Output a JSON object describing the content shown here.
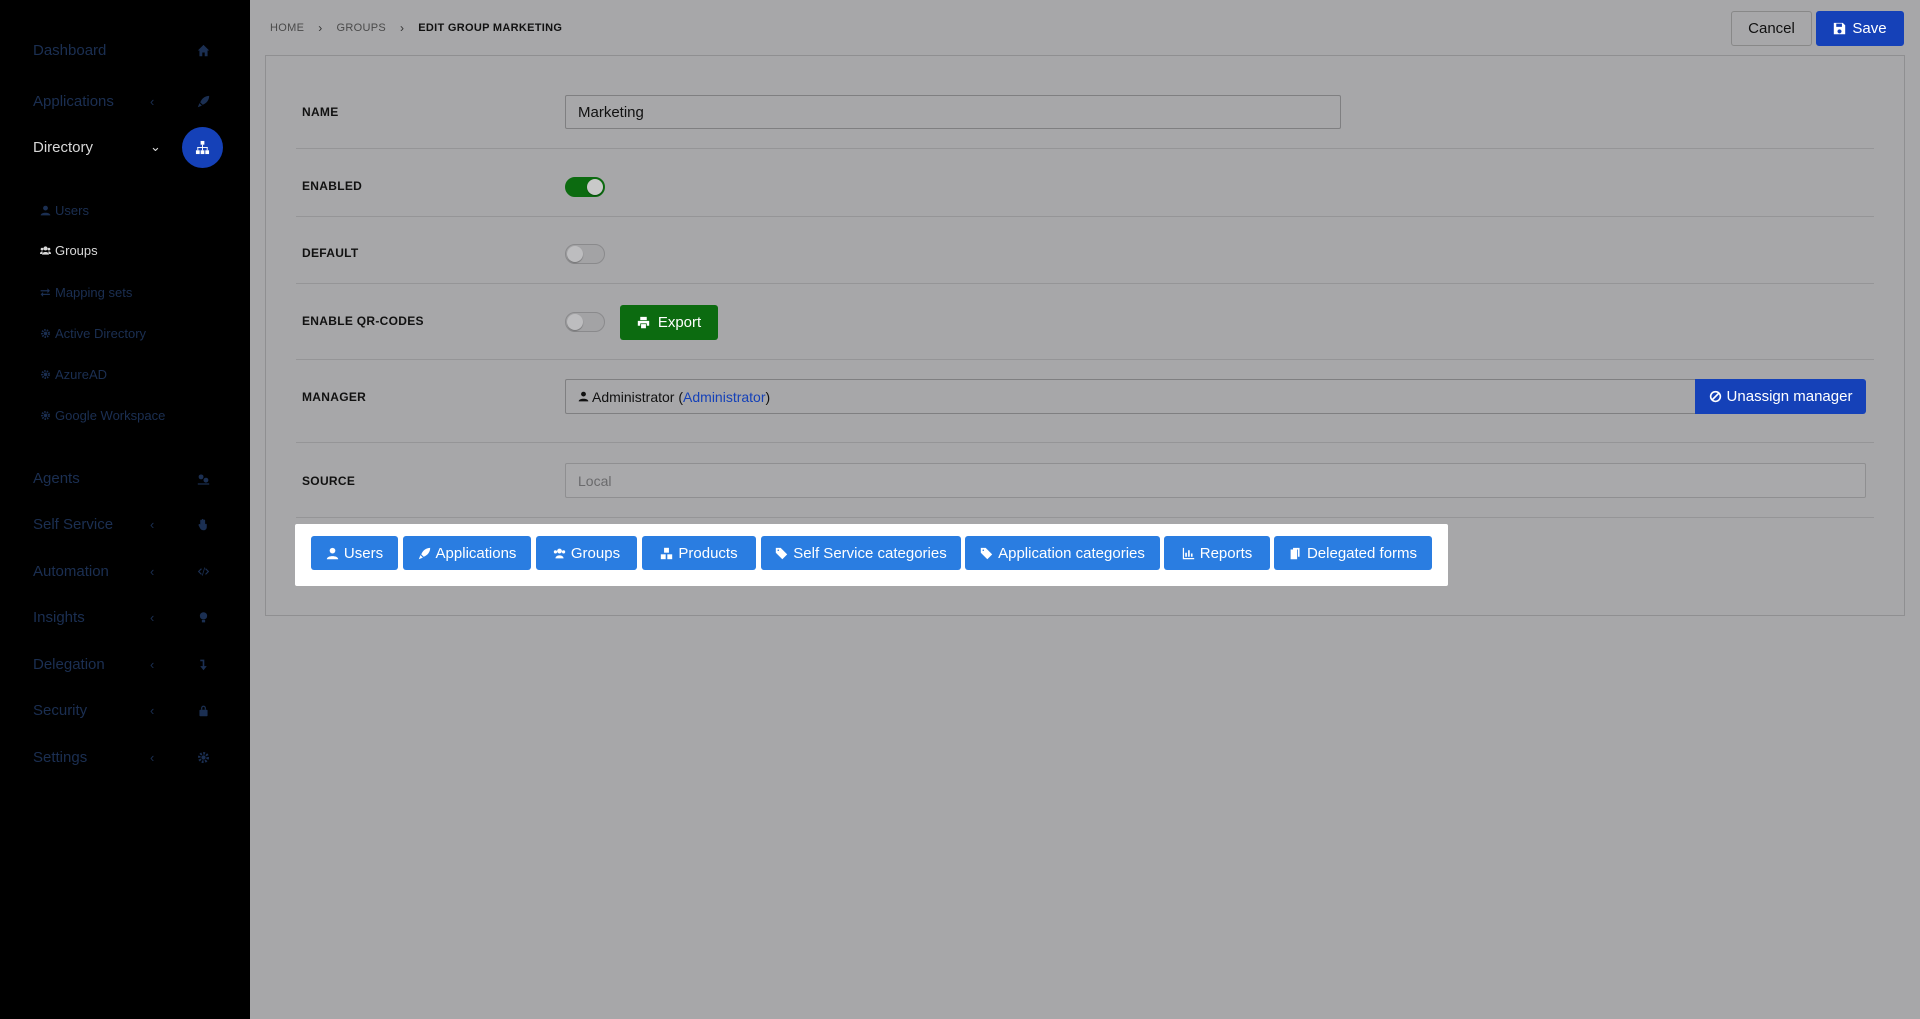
{
  "sidebar": {
    "items": [
      {
        "label": "Dashboard",
        "icon": "home-icon"
      },
      {
        "label": "Applications",
        "icon": "rocket-icon"
      },
      {
        "label": "Directory",
        "icon": "sitemap-icon"
      },
      {
        "label": "Agents",
        "icon": "agents-icon"
      },
      {
        "label": "Self Service",
        "icon": "hand-icon"
      },
      {
        "label": "Automation",
        "icon": "code-icon"
      },
      {
        "label": "Insights",
        "icon": "lightbulb-icon"
      },
      {
        "label": "Delegation",
        "icon": "delegation-icon"
      },
      {
        "label": "Security",
        "icon": "lock-icon"
      },
      {
        "label": "Settings",
        "icon": "gear-icon"
      }
    ],
    "directory_subitems": [
      {
        "label": "Users",
        "icon": "user-icon"
      },
      {
        "label": "Groups",
        "icon": "users-icon"
      },
      {
        "label": "Mapping sets",
        "icon": "exchange-icon"
      },
      {
        "label": "Active Directory",
        "icon": "gear-icon"
      },
      {
        "label": "AzureAD",
        "icon": "gear-icon"
      },
      {
        "label": "Google Workspace",
        "icon": "gear-icon"
      }
    ]
  },
  "breadcrumb": [
    "HOME",
    "GROUPS",
    "EDIT GROUP MARKETING"
  ],
  "toolbar": {
    "cancel_label": "Cancel",
    "save_label": "Save"
  },
  "form": {
    "name_label": "NAME",
    "name_value": "Marketing",
    "enabled_label": "ENABLED",
    "enabled": true,
    "default_label": "DEFAULT",
    "default": false,
    "qr_label": "ENABLE QR-CODES",
    "qr_enabled": false,
    "export_label": "Export",
    "manager_label": "MANAGER",
    "manager_name": "Administrator",
    "manager_link": "Administrator",
    "unassign_label": "Unassign manager",
    "source_label": "SOURCE",
    "source_value": "Local"
  },
  "tabs": [
    {
      "label": "Users",
      "icon": "user-icon"
    },
    {
      "label": "Applications",
      "icon": "rocket-icon"
    },
    {
      "label": "Groups",
      "icon": "users-icon"
    },
    {
      "label": "Products",
      "icon": "cubes-icon"
    },
    {
      "label": "Self Service categories",
      "icon": "tags-icon"
    },
    {
      "label": "Application categories",
      "icon": "tags-icon"
    },
    {
      "label": "Reports",
      "icon": "bar-chart-icon"
    },
    {
      "label": "Delegated forms",
      "icon": "copy-icon"
    }
  ],
  "colors": {
    "primary": "#1541b8",
    "tab_button": "#2a7de1",
    "success": "#0c6b10",
    "sidebar_bg": "#000000",
    "overlay_bg": "#a7a7a9"
  }
}
